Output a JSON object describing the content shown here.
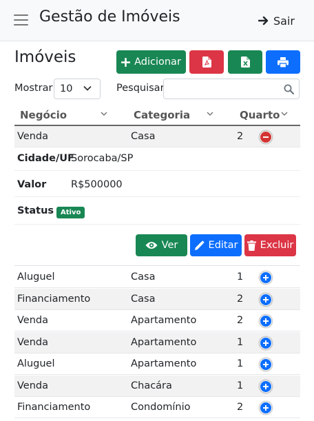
{
  "app": {
    "title": "Gestão de Imóveis",
    "logout_label": "Sair"
  },
  "page": {
    "heading": "Imóveis"
  },
  "toolbar": {
    "add_label": "Adicionar"
  },
  "filters": {
    "show_label": "Mostrar",
    "page_size": "10",
    "search_label": "Pesquisar",
    "search_value": ""
  },
  "table": {
    "columns": [
      "Negócio",
      "Categoria",
      "Quarto"
    ],
    "expanded_row": {
      "negocio": "Venda",
      "categoria": "Casa",
      "quarto": "2"
    },
    "detail": {
      "city_label": "Cidade/UF",
      "city_value": "Sorocaba/SP",
      "value_label": "Valor",
      "value_value": "R$500000",
      "status_label": "Status",
      "status_value": "Ativo"
    },
    "actions": {
      "view_label": "Ver",
      "edit_label": "Editar",
      "delete_label": "Excluir"
    },
    "rows": [
      {
        "negocio": "Aluguel",
        "categoria": "Casa",
        "quarto": "1"
      },
      {
        "negocio": "Financiamento",
        "categoria": "Casa",
        "quarto": "2"
      },
      {
        "negocio": "Venda",
        "categoria": "Apartamento",
        "quarto": "2"
      },
      {
        "negocio": "Venda",
        "categoria": "Apartamento",
        "quarto": "1"
      },
      {
        "negocio": "Aluguel",
        "categoria": "Apartamento",
        "quarto": "1"
      },
      {
        "negocio": "Venda",
        "categoria": "Chacára",
        "quarto": "1"
      },
      {
        "negocio": "Financiamento",
        "categoria": "Condomínio",
        "quarto": "2"
      }
    ]
  },
  "colors": {
    "success": "#198754",
    "danger": "#dc3545",
    "primary": "#0d6efd"
  }
}
